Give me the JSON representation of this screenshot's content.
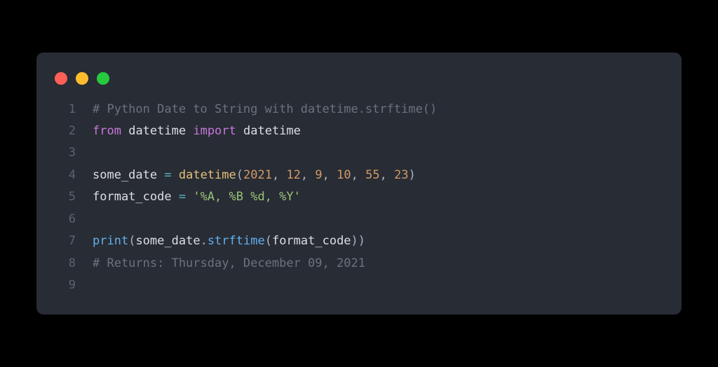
{
  "colors": {
    "background": "#000000",
    "editor_bg": "#282c34",
    "lineno": "#5c6370",
    "comment": "#6a737d",
    "keyword": "#c678dd",
    "builtin": "#61afef",
    "func": "#e5c07b",
    "string": "#98c379",
    "number": "#d19a66",
    "default": "#dcdfe4",
    "operator": "#56b6c2",
    "traffic_red": "#ff5f56",
    "traffic_yellow": "#ffbd2e",
    "traffic_green": "#27c93f"
  },
  "lines": {
    "1": {
      "num": "1"
    },
    "2": {
      "num": "2"
    },
    "3": {
      "num": "3"
    },
    "4": {
      "num": "4"
    },
    "5": {
      "num": "5"
    },
    "6": {
      "num": "6"
    },
    "7": {
      "num": "7"
    },
    "8": {
      "num": "8"
    },
    "9": {
      "num": "9"
    }
  },
  "tokens": {
    "l1_comment": "# Python Date to String with datetime.strftime()",
    "l2_from": "from",
    "l2_sp1": " ",
    "l2_datetime1": "datetime",
    "l2_sp2": " ",
    "l2_import": "import",
    "l2_sp3": " ",
    "l2_datetime2": "datetime",
    "l4_var": "some_date ",
    "l4_eq": "=",
    "l4_sp": " ",
    "l4_fn": "datetime",
    "l4_open": "(",
    "l4_n1": "2021",
    "l4_c1": ", ",
    "l4_n2": "12",
    "l4_c2": ", ",
    "l4_n3": "9",
    "l4_c3": ", ",
    "l4_n4": "10",
    "l4_c4": ", ",
    "l4_n5": "55",
    "l4_c5": ", ",
    "l4_n6": "23",
    "l4_close": ")",
    "l5_var": "format_code ",
    "l5_eq": "=",
    "l5_sp": " ",
    "l5_str": "'%A, %B %d, %Y'",
    "l7_print": "print",
    "l7_open1": "(",
    "l7_obj": "some_date",
    "l7_dot": ".",
    "l7_method": "strftime",
    "l7_open2": "(",
    "l7_arg": "format_code",
    "l7_close2": ")",
    "l7_close1": ")",
    "l8_comment": "# Returns: Thursday, December 09, 2021"
  }
}
